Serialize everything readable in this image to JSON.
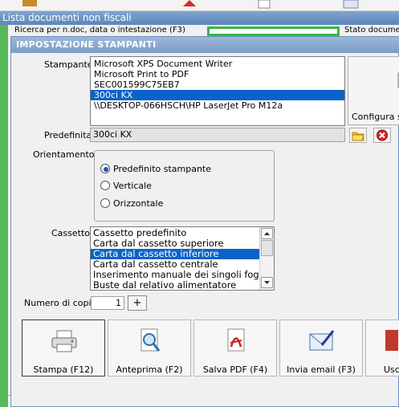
{
  "background_window": {
    "title": "Lista documenti non fiscali",
    "search_label": "Ricerca per n.doc, data o intestazione (F3)",
    "status_label": "Stato docume"
  },
  "dialog": {
    "title": "IMPOSTAZIONE STAMPANTI",
    "printer_label": "Stampante",
    "printers": [
      "Microsoft XPS Document Writer",
      "Microsoft Print to PDF",
      "SEC001599C75EB7",
      "300ci KX",
      "\\\\DESKTOP-066HSCH\\HP LaserJet Pro M12a"
    ],
    "selected_printer_index": 3,
    "configure_label": "Configura st",
    "default_label": "Predefinita",
    "default_value": "300ci KX",
    "orientation_label": "Orientamento",
    "orientation_options": [
      "Predefinito stampante",
      "Verticale",
      "Orizzontale"
    ],
    "selected_orientation_index": 0,
    "tray_label": "Cassetto",
    "trays": [
      "Cassetto predefinito",
      "Carta dal cassetto superiore",
      "Carta dal cassetto inferiore",
      "Carta dal cassetto centrale",
      "Inserimento manuale dei singoli fog",
      "Buste dal relativo alimentatore"
    ],
    "selected_tray_index": 2,
    "copies_label": "Numero di copie",
    "copies_value": "1",
    "copies_plus": "+",
    "actions": [
      {
        "label": "Stampa (F12)",
        "icon": "printer-icon"
      },
      {
        "label": "Anteprima (F2)",
        "icon": "magnifier-icon"
      },
      {
        "label": "Salva PDF (F4)",
        "icon": "pdf-icon"
      },
      {
        "label": "Invia email (F3)",
        "icon": "email-icon"
      },
      {
        "label": "Usci",
        "icon": "exit-icon"
      }
    ]
  },
  "colors": {
    "selection": "#0a63c9",
    "title_bar": "#7b9dc8",
    "accent_green": "#3cb54a"
  }
}
